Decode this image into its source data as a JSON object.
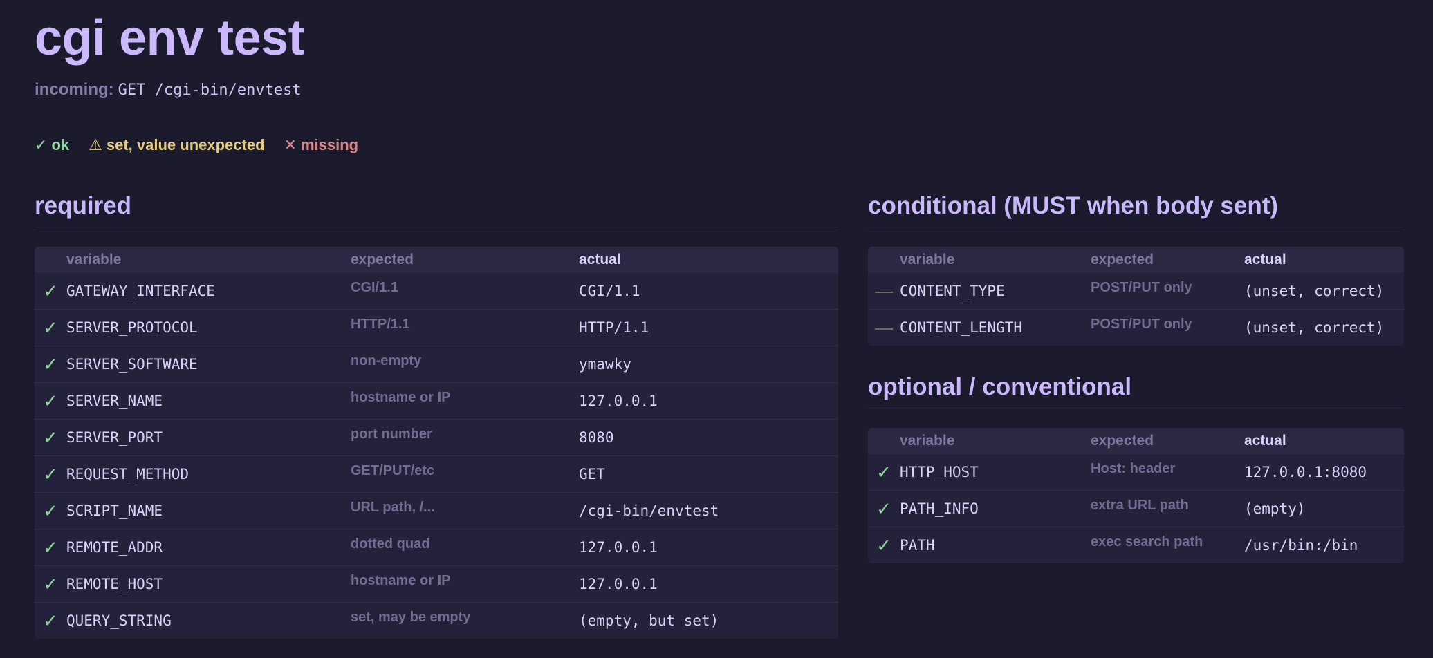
{
  "page": {
    "title": "cgi env test",
    "incoming_label": "incoming:",
    "incoming_value": "GET /cgi-bin/envtest"
  },
  "legend": {
    "ok_glyph": "✓",
    "ok_label": "ok",
    "warn_glyph": "⚠",
    "warn_label": "set, value unexpected",
    "missing_glyph": "✕",
    "missing_label": "missing"
  },
  "colors": {
    "ok": "#8fd49a",
    "warn": "#e3cc7a",
    "missing": "#d98585",
    "accent": "#c9b8fb",
    "background": "#1c1b2e"
  },
  "required": {
    "heading": "required",
    "columns": {
      "variable": "variable",
      "expected": "expected",
      "actual": "actual"
    },
    "rows": [
      {
        "status": "ok",
        "icon": "check-icon",
        "variable": "GATEWAY_INTERFACE",
        "expected": "CGI/1.1",
        "actual": "CGI/1.1"
      },
      {
        "status": "ok",
        "icon": "check-icon",
        "variable": "SERVER_PROTOCOL",
        "expected": "HTTP/1.1",
        "actual": "HTTP/1.1"
      },
      {
        "status": "ok",
        "icon": "check-icon",
        "variable": "SERVER_SOFTWARE",
        "expected": "non-empty",
        "actual": "ymawky"
      },
      {
        "status": "ok",
        "icon": "check-icon",
        "variable": "SERVER_NAME",
        "expected": "hostname or IP",
        "actual": "127.0.0.1"
      },
      {
        "status": "ok",
        "icon": "check-icon",
        "variable": "SERVER_PORT",
        "expected": "port number",
        "actual": "8080"
      },
      {
        "status": "ok",
        "icon": "check-icon",
        "variable": "REQUEST_METHOD",
        "expected": "GET/PUT/etc",
        "actual": "GET"
      },
      {
        "status": "ok",
        "icon": "check-icon",
        "variable": "SCRIPT_NAME",
        "expected": "URL path, /...",
        "actual": "/cgi-bin/envtest"
      },
      {
        "status": "ok",
        "icon": "check-icon",
        "variable": "REMOTE_ADDR",
        "expected": "dotted quad",
        "actual": "127.0.0.1"
      },
      {
        "status": "ok",
        "icon": "check-icon",
        "variable": "REMOTE_HOST",
        "expected": "hostname or IP",
        "actual": "127.0.0.1"
      },
      {
        "status": "ok",
        "icon": "check-icon",
        "variable": "QUERY_STRING",
        "expected": "set, may be empty",
        "actual": "(empty, but set)"
      }
    ]
  },
  "conditional": {
    "heading": "conditional (MUST when body sent)",
    "columns": {
      "variable": "variable",
      "expected": "expected",
      "actual": "actual"
    },
    "rows": [
      {
        "status": "na",
        "icon": "dash-icon",
        "variable": "CONTENT_TYPE",
        "expected": "POST/PUT only",
        "actual": "(unset, correct)"
      },
      {
        "status": "na",
        "icon": "dash-icon",
        "variable": "CONTENT_LENGTH",
        "expected": "POST/PUT only",
        "actual": "(unset, correct)"
      }
    ]
  },
  "optional": {
    "heading": "optional / conventional",
    "columns": {
      "variable": "variable",
      "expected": "expected",
      "actual": "actual"
    },
    "rows": [
      {
        "status": "ok",
        "icon": "check-icon",
        "variable": "HTTP_HOST",
        "expected": "Host: header",
        "actual": "127.0.0.1:8080"
      },
      {
        "status": "ok",
        "icon": "check-icon",
        "variable": "PATH_INFO",
        "expected": "extra URL path",
        "actual": "(empty)"
      },
      {
        "status": "ok",
        "icon": "check-icon",
        "variable": "PATH",
        "expected": "exec search path",
        "actual": "/usr/bin:/bin"
      }
    ]
  }
}
